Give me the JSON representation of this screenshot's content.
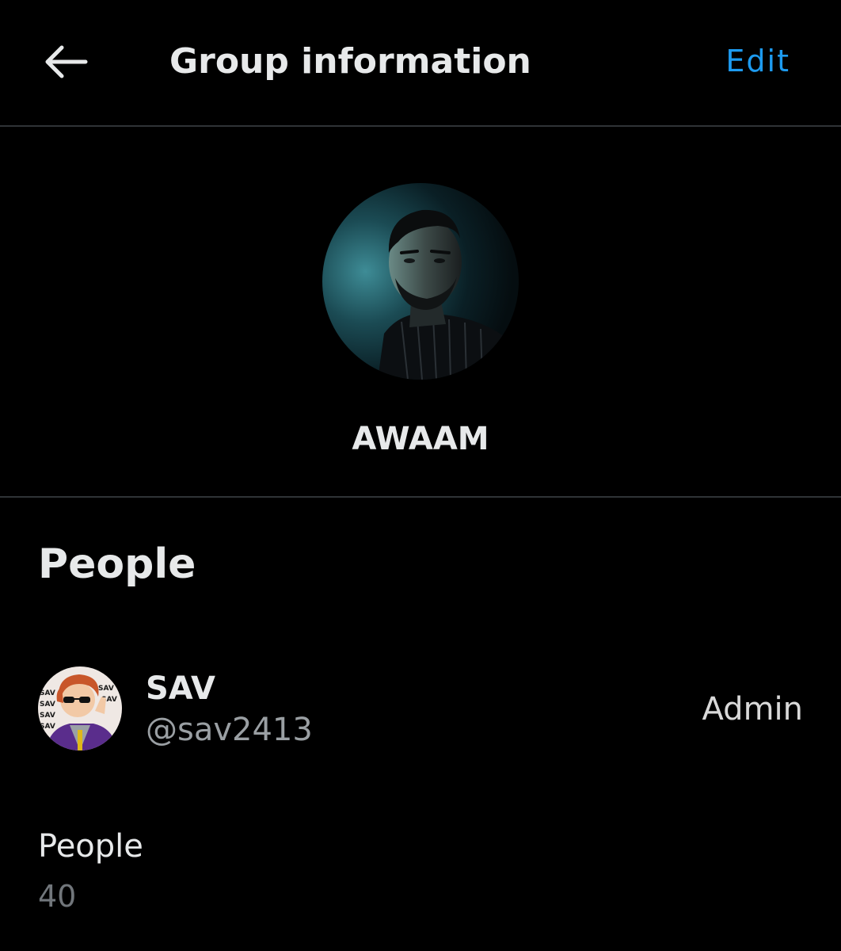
{
  "header": {
    "back_icon": "arrow-left-icon",
    "title": "Group information",
    "edit_label": "Edit"
  },
  "group": {
    "name": "AWAAM",
    "avatar": "group-avatar-photo"
  },
  "people_section": {
    "heading": "People",
    "members": [
      {
        "name": "SAV",
        "handle": "@sav2413",
        "role": "Admin",
        "avatar": "member-avatar-cartoon"
      }
    ],
    "count_label": "People",
    "count_value": "40"
  },
  "colors": {
    "background": "#000000",
    "accent": "#1d9bf0",
    "primary_text": "#e7e9ea",
    "secondary_text": "#71767b",
    "divider": "#2f3336"
  }
}
